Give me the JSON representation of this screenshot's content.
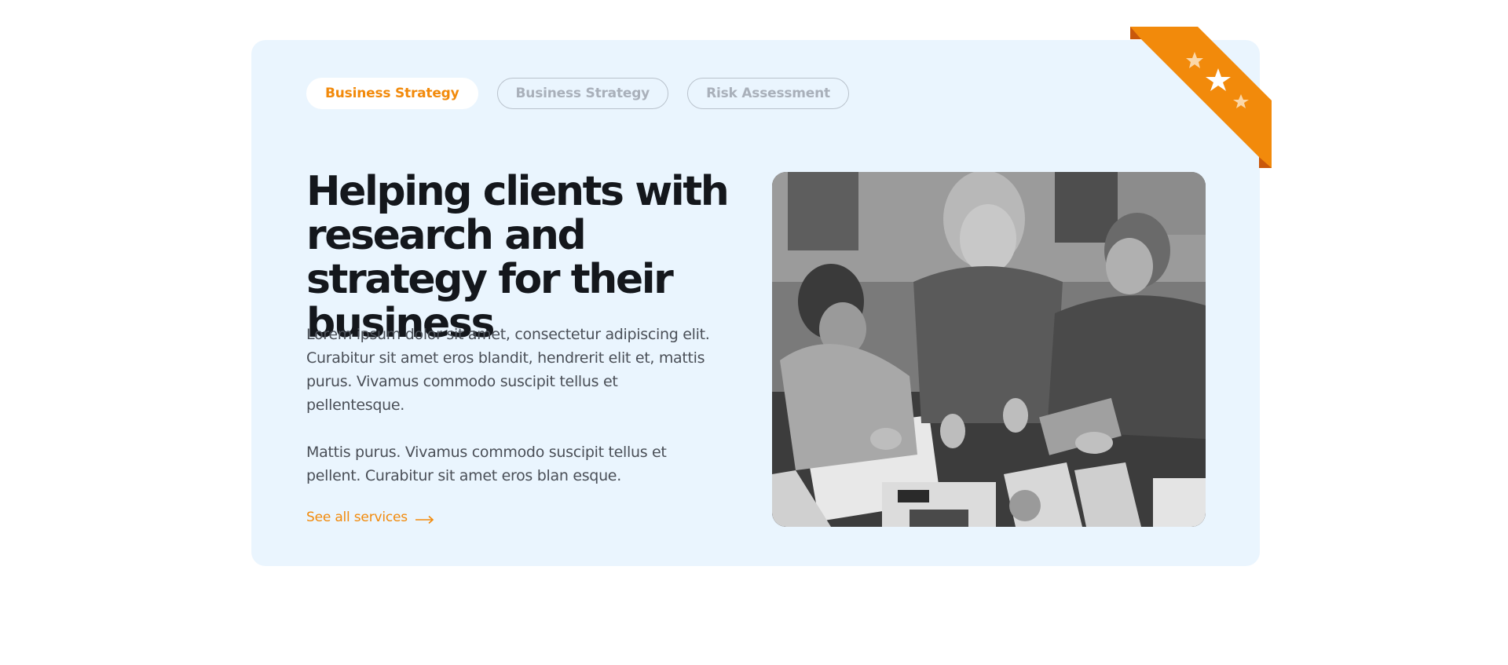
{
  "tabs": [
    {
      "label": "Business Strategy",
      "active": true
    },
    {
      "label": "Business Strategy",
      "active": false
    },
    {
      "label": "Risk Assessment",
      "active": false
    }
  ],
  "main": {
    "heading": "Helping clients with research and strategy for their business",
    "paragraph_1": "Lorem ipsum dolor sit amet, consectetur adipiscing elit. Curabitur sit amet eros blandit, hendrerit elit et, mattis purus. Vivamus commodo suscipit tellus et pellentesque.",
    "paragraph_2": "Mattis purus. Vivamus commodo suscipit tellus et pellent. Curabitur sit amet eros blan esque.",
    "link_label": "See all services"
  },
  "photo": {
    "subject": "team-meeting-photo"
  },
  "ribbon": {
    "icon": "stars-icon"
  },
  "colors": {
    "accent": "#f28a0b",
    "card_bg": "#eaf5fe",
    "heading": "#14171c",
    "body_text": "#4a4f57",
    "inactive_tab": "#a9b0ba"
  }
}
